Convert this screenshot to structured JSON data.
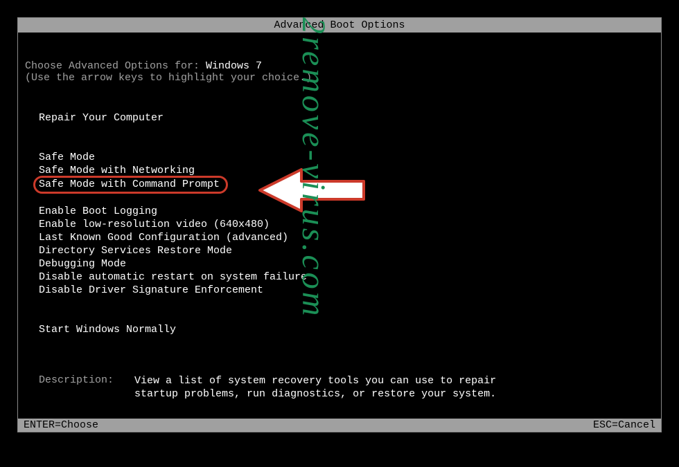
{
  "title": "Advanced Boot Options",
  "prompt": {
    "label": "Choose Advanced Options for: ",
    "os": "Windows 7"
  },
  "hint": "(Use the arrow keys to highlight your choice.)",
  "groups": {
    "repair": {
      "item": "Repair Your Computer"
    },
    "safe": {
      "mode": "Safe Mode",
      "networking": "Safe Mode with Networking",
      "cmd": "Safe Mode with Command Prompt"
    },
    "advanced": {
      "bootlog": "Enable Boot Logging",
      "lowres": "Enable low-resolution video (640x480)",
      "lkgc": "Last Known Good Configuration (advanced)",
      "dsrm": "Directory Services Restore Mode",
      "debug": "Debugging Mode",
      "norestart": "Disable automatic restart on system failure",
      "nosig": "Disable Driver Signature Enforcement"
    },
    "normal": {
      "item": "Start Windows Normally"
    }
  },
  "description": {
    "label": "Description:",
    "text": "View a list of system recovery tools you can use to repair startup problems, run diagnostics, or restore your system."
  },
  "footer": {
    "enter": "ENTER=Choose",
    "esc": "ESC=Cancel"
  },
  "watermark": "2remove-virus.com",
  "annotation": {
    "highlight_color": "#cc3a2a",
    "arrow_points_to": "Safe Mode with Command Prompt"
  }
}
